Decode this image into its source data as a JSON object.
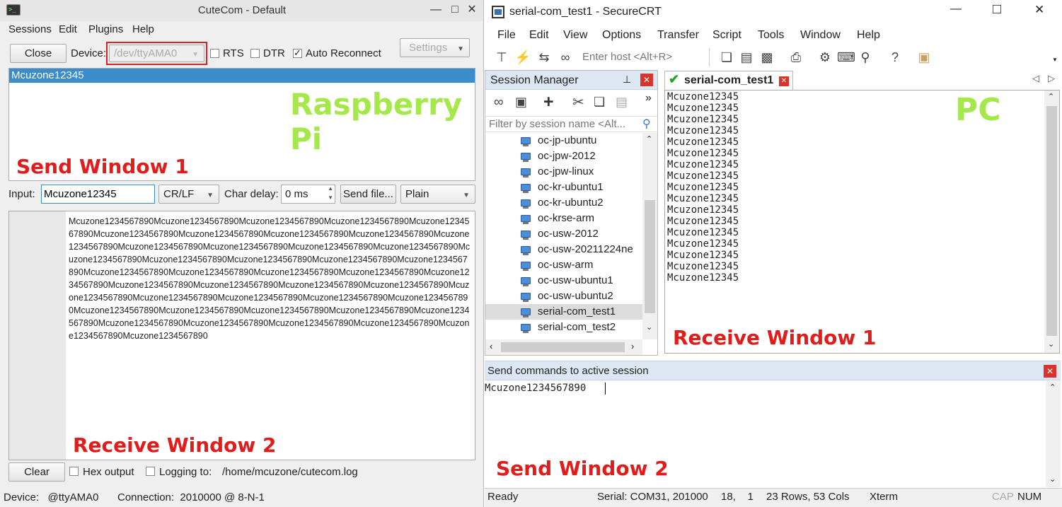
{
  "cutecom": {
    "title": "CuteCom - Default",
    "menu": [
      "Sessions",
      "Edit",
      "Plugins",
      "Help"
    ],
    "close_label": "Close",
    "device_label": "Device:",
    "device_value": "/dev/ttyAMA0",
    "rts_label": "RTS",
    "dtr_label": "DTR",
    "auto_reconnect_label": "Auto Reconnect",
    "settings_label": "Settings",
    "send_window_history": "Mcuzone12345",
    "overlay_device": "Raspberry Pi",
    "send_window_label": "Send Window 1",
    "input_label": "Input:",
    "input_value": "Mcuzone12345",
    "line_ending": "CR/LF",
    "char_delay_label": "Char delay:",
    "char_delay_value": "0 ms",
    "send_file_label": "Send file...",
    "format_value": "Plain",
    "receive_text": "Mcuzone1234567890Mcuzone1234567890Mcuzone1234567890Mcuzone1234567890Mcuzone1234567890Mcuzone1234567890Mcuzone1234567890Mcuzone1234567890Mcuzone1234567890Mcuzone1234567890Mcuzone1234567890Mcuzone1234567890Mcuzone1234567890Mcuzone1234567890Mcuzone1234567890Mcuzone1234567890Mcuzone1234567890Mcuzone1234567890Mcuzone1234567890Mcuzone1234567890Mcuzone1234567890Mcuzone1234567890Mcuzone1234567890Mcuzone1234567890Mcuzone1234567890Mcuzone1234567890Mcuzone1234567890Mcuzone1234567890Mcuzone1234567890Mcuzone1234567890Mcuzone1234567890Mcuzone1234567890Mcuzone1234567890Mcuzone1234567890Mcuzone1234567890Mcuzone1234567890Mcuzone1234567890Mcuzone1234567890Mcuzone1234567890Mcuzone1234567890Mcuzone1234567890Mcuzone1234567890Mcuzone1234567890Mcuzone1234567890",
    "receive_window_label": "Receive Window 2",
    "clear_label": "Clear",
    "hex_output_label": "Hex output",
    "logging_label": "Logging to:",
    "log_path": "/home/mcuzone/cutecom.log",
    "status_device": "Device:   @ttyAMA0",
    "status_connection": "Connection:  2010000 @ 8-N-1"
  },
  "securecrt": {
    "title": "serial-com_test1 - SecureCRT",
    "menu": [
      "File",
      "Edit",
      "View",
      "Options",
      "Transfer",
      "Script",
      "Tools",
      "Window",
      "Help"
    ],
    "host_placeholder": "Enter host <Alt+R>",
    "session_manager_title": "Session Manager",
    "filter_placeholder": "Filter by session name <Alt...",
    "sessions": [
      "oc-jp-ubuntu",
      "oc-jpw-2012",
      "oc-jpw-linux",
      "oc-kr-ubuntu1",
      "oc-kr-ubuntu2",
      "oc-krse-arm",
      "oc-usw-2012",
      "oc-usw-20211224ne",
      "oc-usw-arm",
      "oc-usw-ubuntu1",
      "oc-usw-ubuntu2",
      "serial-com_test1",
      "serial-com_test2"
    ],
    "selected_session": "serial-com_test1",
    "tab_label": "serial-com_test1",
    "terminal_lines": [
      "Mcuzone12345",
      "Mcuzone12345",
      "Mcuzone12345",
      "Mcuzone12345",
      "Mcuzone12345",
      "Mcuzone12345",
      "Mcuzone12345",
      "Mcuzone12345",
      "Mcuzone12345",
      "Mcuzone12345",
      "Mcuzone12345",
      "Mcuzone12345",
      "Mcuzone12345",
      "Mcuzone12345",
      "Mcuzone12345",
      "Mcuzone12345",
      "Mcuzone12345"
    ],
    "overlay_device": "PC",
    "receive_window_label": "Receive Window 1",
    "send_commands_title": "Send commands to active session",
    "send_text": "Mcuzone1234567890",
    "send_window_label": "Send Window 2",
    "status": {
      "ready": "Ready",
      "serial": "Serial: COM31, 201000",
      "cursor": "18,    1",
      "size": "23 Rows, 53 Cols",
      "emulation": "Xterm",
      "cap": "CAP",
      "num": "NUM"
    }
  },
  "colors": {
    "overlay_green": "#a4e84a",
    "overlay_red": "#e21b1b",
    "selection_blue": "#3a8ccb",
    "highlight_box": "#e02020"
  }
}
